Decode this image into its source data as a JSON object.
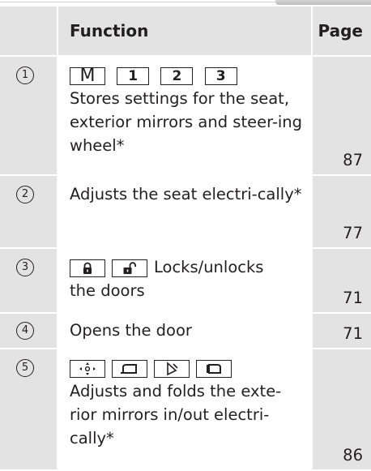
{
  "header": {
    "function": "Function",
    "page": "Page"
  },
  "rows": [
    {
      "num": "1",
      "keys": [
        "M",
        "1",
        "2",
        "3"
      ],
      "text": "Stores settings for the seat, exterior mirrors and steer-ing wheel*",
      "page": "87"
    },
    {
      "num": "2",
      "text": "Adjusts the seat electri-cally*",
      "page": "77"
    },
    {
      "num": "3",
      "icons": [
        "lock-icon",
        "unlock-icon"
      ],
      "text": "Locks/unlocks",
      "text2": "the doors",
      "page": "71"
    },
    {
      "num": "4",
      "text": "Opens the door",
      "page": "71"
    },
    {
      "num": "5",
      "icons": [
        "mirror-adjust-icon",
        "left-mirror-icon",
        "mirror-fold-icon",
        "right-mirror-icon"
      ],
      "text": "Adjusts and folds the exte-rior mirrors in/out electri-cally*",
      "page": "86"
    }
  ]
}
